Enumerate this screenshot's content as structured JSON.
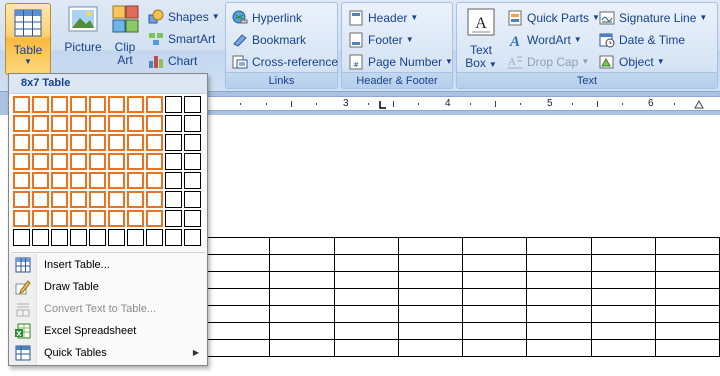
{
  "ribbon": {
    "table_label": "Table",
    "picture_label": "Picture",
    "clipart_label_1": "Clip",
    "clipart_label_2": "Art",
    "shapes_label": "Shapes",
    "smartart_label": "SmartArt",
    "chart_label": "Chart",
    "links": {
      "hyperlink": "Hyperlink",
      "bookmark": "Bookmark",
      "crossref": "Cross-reference",
      "group_label": "Links"
    },
    "header_footer": {
      "header": "Header",
      "footer": "Footer",
      "page_number": "Page Number",
      "group_label": "Header & Footer"
    },
    "text": {
      "textbox_1": "Text",
      "textbox_2": "Box",
      "quick_parts": "Quick Parts",
      "wordart": "WordArt",
      "drop_cap": "Drop Cap",
      "signature_line": "Signature Line",
      "date_time": "Date & Time",
      "object": "Object",
      "group_label": "Text"
    }
  },
  "ruler": {
    "numbers": [
      "3",
      "4",
      "5",
      "6"
    ]
  },
  "menu": {
    "header": "8x7 Table",
    "grid": {
      "cols": 10,
      "rows": 8,
      "selected_cols": 8,
      "selected_rows": 7
    },
    "items": [
      {
        "label": "Insert Table...",
        "disabled": false,
        "icon": "insert-table-icon"
      },
      {
        "label": "Draw Table",
        "disabled": false,
        "icon": "pencil-icon"
      },
      {
        "label": "Convert Text to Table...",
        "disabled": true,
        "icon": "convert-text-icon"
      },
      {
        "label": "Excel Spreadsheet",
        "disabled": false,
        "icon": "excel-icon"
      },
      {
        "label": "Quick Tables",
        "disabled": false,
        "icon": "quick-tables-icon",
        "submenu": true
      }
    ]
  },
  "colors": {
    "grid_highlight": "#e8741f",
    "ribbon_text": "#15428b"
  }
}
